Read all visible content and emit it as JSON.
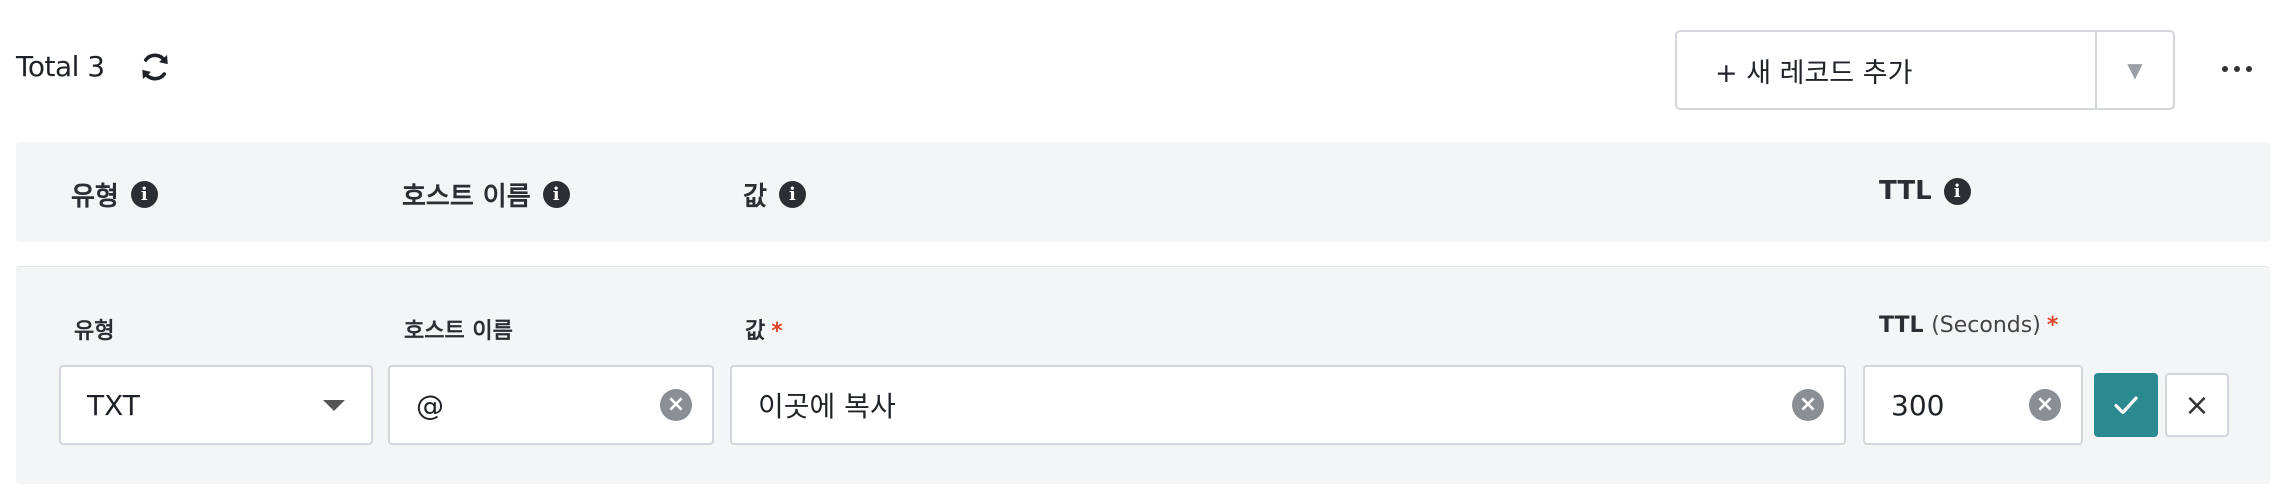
{
  "toolbar": {
    "total_label": "Total 3",
    "refresh_icon": "refresh-icon",
    "add_record_label": "+ 새 레코드 추가",
    "dropdown_icon": "triangle-down-icon",
    "more_icon": "more-horizontal-icon"
  },
  "table_header": {
    "columns": [
      {
        "label": "유형",
        "info_icon": "info-icon"
      },
      {
        "label": "호스트 이름",
        "info_icon": "info-icon"
      },
      {
        "label": "값",
        "info_icon": "info-icon"
      },
      {
        "label": "TTL",
        "info_icon": "info-icon"
      }
    ]
  },
  "edit_row": {
    "type": {
      "label": "유형",
      "value": "TXT"
    },
    "host": {
      "label": "호스트 이름",
      "value": "@"
    },
    "value": {
      "label": "값",
      "required_mark": "*",
      "value": "이곳에 복사"
    },
    "ttl": {
      "label": "TTL",
      "unit": "(Seconds)",
      "required_mark": "*",
      "value": "300"
    },
    "confirm_icon": "check-icon",
    "cancel_icon": "close-icon",
    "cancel_glyph": "×",
    "clear_glyph": "×"
  },
  "colors": {
    "accent": "#2a8a8f",
    "required": "#e0452b",
    "panel_bg": "#f4f5f7",
    "border": "#d3d6db"
  }
}
